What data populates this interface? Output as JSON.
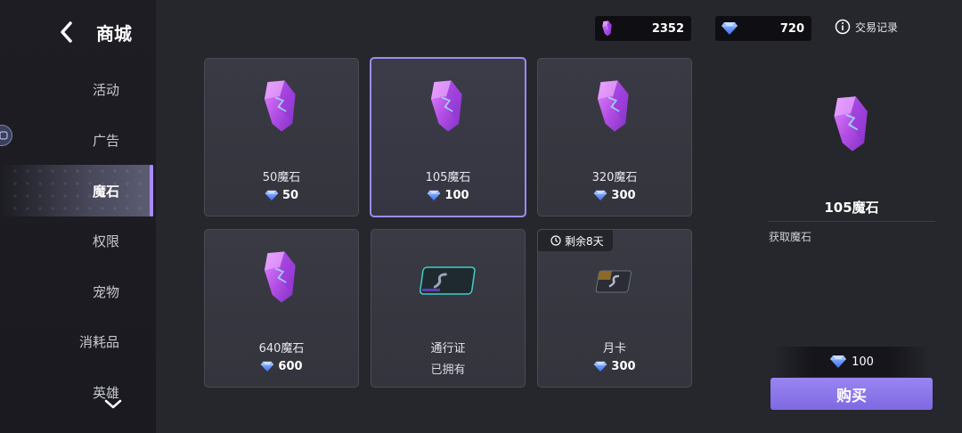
{
  "header": {
    "title": "商城"
  },
  "sidebar": {
    "items": [
      {
        "label": "活动",
        "active": false
      },
      {
        "label": "广告",
        "active": false
      },
      {
        "label": "魔石",
        "active": true
      },
      {
        "label": "权限",
        "active": false
      },
      {
        "label": "宠物",
        "active": false
      },
      {
        "label": "消耗品",
        "active": false
      },
      {
        "label": "英雄",
        "active": false
      }
    ]
  },
  "currencies": {
    "magic_stone": {
      "icon": "magic-stone-icon",
      "amount": "2352"
    },
    "diamond": {
      "icon": "diamond-icon",
      "amount": "720"
    }
  },
  "history": {
    "icon": "info-icon",
    "label": "交易记录"
  },
  "products": [
    {
      "name": "50魔石",
      "price": "50",
      "icon": "magic-stone-crystal"
    },
    {
      "name": "105魔石",
      "price": "100",
      "icon": "magic-stone-crystal",
      "selected": true
    },
    {
      "name": "320魔石",
      "price": "300",
      "icon": "magic-stone-crystal"
    },
    {
      "name": "640魔石",
      "price": "600",
      "icon": "magic-stone-crystal"
    },
    {
      "name": "通行证",
      "status": "已拥有",
      "icon": "pass-card"
    },
    {
      "name": "月卡",
      "price": "300",
      "icon": "month-card",
      "timer": "剩余8天"
    }
  ],
  "detail": {
    "name": "105魔石",
    "description": "获取魔石",
    "cost": "100",
    "buy_label": "购买"
  },
  "colors": {
    "accent": "#9b8cf0",
    "crystal": "#b64ee8",
    "diamond": "#5b8cff",
    "background": "#26262d"
  }
}
